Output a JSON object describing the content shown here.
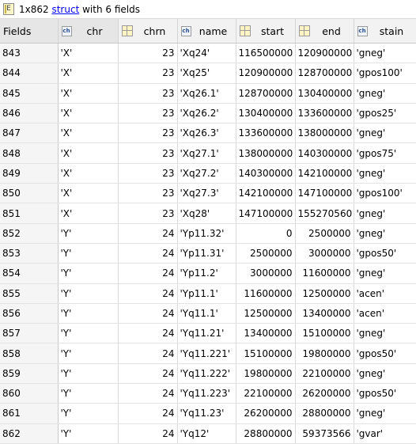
{
  "title": {
    "prefix": "1x862 ",
    "link": "struct",
    "suffix": " with 6 fields"
  },
  "columns": [
    {
      "label": "Fields",
      "type": "rowheader"
    },
    {
      "label": "chr",
      "type": "char"
    },
    {
      "label": "chrn",
      "type": "num"
    },
    {
      "label": "name",
      "type": "char"
    },
    {
      "label": "start",
      "type": "num"
    },
    {
      "label": "end",
      "type": "num"
    },
    {
      "label": "stain",
      "type": "char"
    }
  ],
  "rows": [
    [
      "843",
      "'X'",
      "23",
      "'Xq24'",
      "116500000",
      "120900000",
      "'gneg'"
    ],
    [
      "844",
      "'X'",
      "23",
      "'Xq25'",
      "120900000",
      "128700000",
      "'gpos100'"
    ],
    [
      "845",
      "'X'",
      "23",
      "'Xq26.1'",
      "128700000",
      "130400000",
      "'gneg'"
    ],
    [
      "846",
      "'X'",
      "23",
      "'Xq26.2'",
      "130400000",
      "133600000",
      "'gpos25'"
    ],
    [
      "847",
      "'X'",
      "23",
      "'Xq26.3'",
      "133600000",
      "138000000",
      "'gneg'"
    ],
    [
      "848",
      "'X'",
      "23",
      "'Xq27.1'",
      "138000000",
      "140300000",
      "'gpos75'"
    ],
    [
      "849",
      "'X'",
      "23",
      "'Xq27.2'",
      "140300000",
      "142100000",
      "'gneg'"
    ],
    [
      "850",
      "'X'",
      "23",
      "'Xq27.3'",
      "142100000",
      "147100000",
      "'gpos100'"
    ],
    [
      "851",
      "'X'",
      "23",
      "'Xq28'",
      "147100000",
      "155270560",
      "'gneg'"
    ],
    [
      "852",
      "'Y'",
      "24",
      "'Yp11.32'",
      "0",
      "2500000",
      "'gneg'"
    ],
    [
      "853",
      "'Y'",
      "24",
      "'Yp11.31'",
      "2500000",
      "3000000",
      "'gpos50'"
    ],
    [
      "854",
      "'Y'",
      "24",
      "'Yp11.2'",
      "3000000",
      "11600000",
      "'gneg'"
    ],
    [
      "855",
      "'Y'",
      "24",
      "'Yp11.1'",
      "11600000",
      "12500000",
      "'acen'"
    ],
    [
      "856",
      "'Y'",
      "24",
      "'Yq11.1'",
      "12500000",
      "13400000",
      "'acen'"
    ],
    [
      "857",
      "'Y'",
      "24",
      "'Yq11.21'",
      "13400000",
      "15100000",
      "'gneg'"
    ],
    [
      "858",
      "'Y'",
      "24",
      "'Yq11.221'",
      "15100000",
      "19800000",
      "'gpos50'"
    ],
    [
      "859",
      "'Y'",
      "24",
      "'Yq11.222'",
      "19800000",
      "22100000",
      "'gneg'"
    ],
    [
      "860",
      "'Y'",
      "24",
      "'Yq11.223'",
      "22100000",
      "26200000",
      "'gpos50'"
    ],
    [
      "861",
      "'Y'",
      "24",
      "'Yq11.23'",
      "26200000",
      "28800000",
      "'gneg'"
    ],
    [
      "862",
      "'Y'",
      "24",
      "'Yq12'",
      "28800000",
      "59373566",
      "'gvar'"
    ]
  ]
}
